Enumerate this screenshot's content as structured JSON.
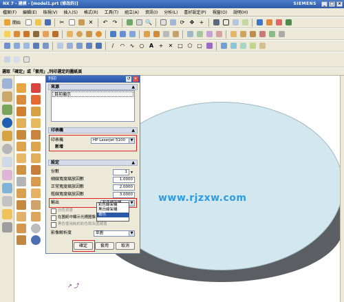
{
  "window": {
    "title": "NX 7 - 建模 - [model1.prt (修改的)]",
    "brand": "SIEMENS",
    "buttons": [
      "_",
      "□",
      "×"
    ]
  },
  "menubar": [
    "檔案(F)",
    "編輯(E)",
    "檢視(V)",
    "插入(S)",
    "格式(R)",
    "工具(T)",
    "組立(A)",
    "資訊(I)",
    "分析(L)",
    "喜好設定(P)",
    "視窗(O)",
    "說明(H)"
  ],
  "toolbar1": {
    "start_label": "開始"
  },
  "status_line": "選取「確定」或「套用」,列印選定的圖紙頁",
  "dialog": {
    "title": "列印",
    "sections": {
      "source": "來源",
      "printer": "印表機",
      "settings": "設定"
    },
    "source_item": "目前顯示",
    "printer": {
      "label": "印表機",
      "value": "HP LaserJet 5100"
    },
    "printer_sub": "新增",
    "copies": {
      "label": "份數",
      "value": "1"
    },
    "thin_width": {
      "label": "細線寬度縮放因數",
      "value": "1.0000"
    },
    "normal_width": {
      "label": "正常寬度縮放因數",
      "value": "2.0000"
    },
    "thick_width": {
      "label": "粗線寬度縮放因數",
      "value": "3.0000"
    },
    "output": {
      "label": "輸出",
      "value": "彩色線架構"
    },
    "output_options": [
      "彩色線架構",
      "黑白線架構",
      "著色"
    ],
    "check_white": "白色背景",
    "check_graphics": "在圖紙中顯示光柵圖像",
    "check_color": "黑色使用純的彩色和灰度線寬",
    "image_res": {
      "label": "影像解析度",
      "value": "草圖"
    },
    "buttons": {
      "ok": "確定",
      "apply": "套用",
      "cancel": "取消"
    }
  },
  "watermark": "www.rjzxw.com",
  "colors": {
    "title_bar": "#2f5aa8",
    "cylinder_top": "#d3e8ee",
    "cylinder_side": "#5b5f63",
    "watermark": "#2e9be8",
    "highlight": "#e02020"
  }
}
